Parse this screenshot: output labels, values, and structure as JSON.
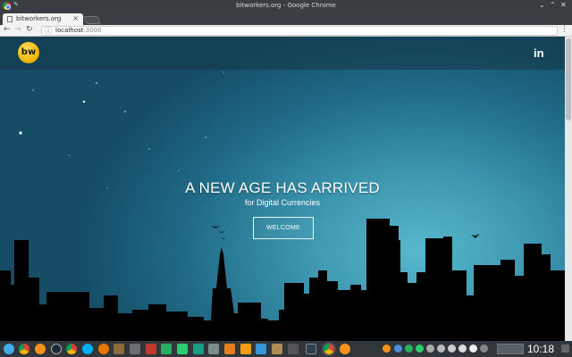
{
  "window": {
    "title": "bitworkers.org - Google Chrome"
  },
  "browser": {
    "tab_title": "bitworkers.org",
    "tab_close": "×",
    "url_host": "localhost",
    "url_port": ":3000"
  },
  "site": {
    "logo_text": "bw",
    "linkedin_label": "in",
    "hero_title": "A NEW AGE HAS ARRIVED",
    "hero_subtitle": "for Digital Currencies",
    "welcome_button": "WELCOME"
  },
  "taskbar": {
    "clock": "10:18",
    "apps": [
      "kde-menu-icon",
      "chrome-icon",
      "bitcoin-icon",
      "steam-icon",
      "chrome-icon",
      "skype-icon",
      "blender-icon",
      "brush-icon",
      "games-icon",
      "sheets-icon",
      "slides-icon",
      "files-icon",
      "archive-icon",
      "vlc-icon",
      "notes-icon",
      "folder-icon",
      "terminal-icon",
      "chrome-icon",
      "bitcoin-icon"
    ]
  },
  "colors": {
    "sky_center": "#57b8cc",
    "sky_edge": "#154d66",
    "logo_gold": "#f2b705",
    "taskbar": "#31363b"
  }
}
